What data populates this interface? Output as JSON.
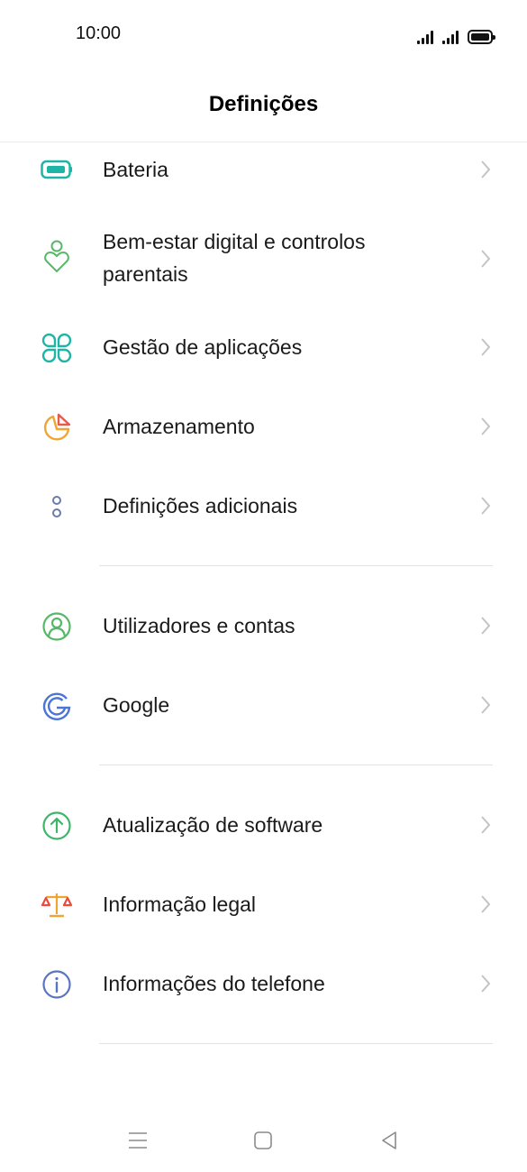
{
  "status": {
    "time": "10:00",
    "icons": [
      "signal-icon",
      "signal-icon",
      "battery-icon"
    ]
  },
  "header": {
    "title": "Definições"
  },
  "settings": {
    "items": [
      {
        "label": "Bateria",
        "icon": "battery-icon",
        "color": "#1fb5a6"
      },
      {
        "label_line1": "Bem-estar digital e controlos",
        "label_line2": "parentais",
        "icon": "digital-wellbeing-icon",
        "color": "#57b868"
      },
      {
        "label": "Gestão de aplicações",
        "icon": "app-management-icon",
        "color": "#1fb5a6"
      },
      {
        "label": "Armazenamento",
        "icon": "storage-icon",
        "color": "#f0a531"
      },
      {
        "label": "Definições adicionais",
        "icon": "additional-settings-icon",
        "color": "#6a7bb0"
      },
      {
        "label": "Utilizadores e contas",
        "icon": "users-accounts-icon",
        "color": "#57b868"
      },
      {
        "label": "Google",
        "icon": "google-icon",
        "color": "#4a74d6"
      },
      {
        "label": "Atualização de software",
        "icon": "software-update-icon",
        "color": "#3fb56b"
      },
      {
        "label": "Informação legal",
        "icon": "legal-info-icon",
        "color": "#f07a3a"
      },
      {
        "label": "Informações do telefone",
        "icon": "phone-info-icon",
        "color": "#5b74c2"
      }
    ]
  },
  "navigation": {
    "buttons": [
      "menu-icon",
      "home-icon",
      "back-icon"
    ]
  }
}
